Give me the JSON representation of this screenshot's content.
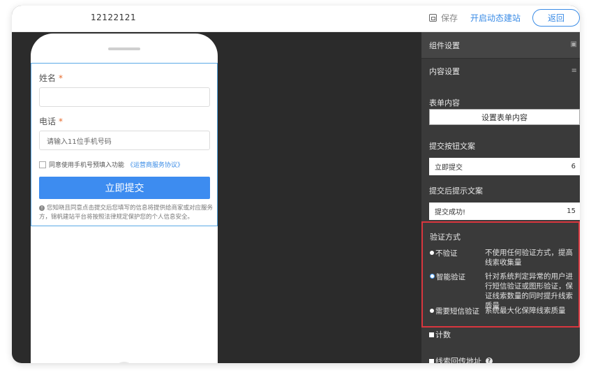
{
  "header": {
    "site_name": "12122121",
    "save_label": "保存",
    "start_label": "开启动态建站",
    "back_label": "返回"
  },
  "form": {
    "name_label": "姓名",
    "name_value": "",
    "phone_label": "电话",
    "phone_placeholder": "请输入11位手机号码",
    "required_mark": "*",
    "agree_text": "同意使用手机号预填入功能",
    "agree_link": "《运营商服务协议》",
    "submit_label": "立即提交",
    "disclaimer": "您知晓且同意点击提交后您填写的信息将提供给商家或对应服务方，锦帆建站平台将按照法律规定保护您的个人信息安全。"
  },
  "panel": {
    "component_settings": "组件设置",
    "content_settings": "内容设置",
    "form_content_label": "表单内容",
    "form_content_button": "设置表单内容",
    "submit_text_label": "提交按钮文案",
    "submit_text_value": "立即提交",
    "submit_text_count": "6",
    "after_submit_label": "提交后提示文案",
    "after_submit_value": "提交成功!",
    "after_submit_count": "15",
    "verify": {
      "title": "验证方式",
      "options": [
        {
          "label": "不验证",
          "desc": "不使用任何验证方式，提高线索收集量"
        },
        {
          "label": "智能验证",
          "desc": "针对系统判定异常的用户进行短信验证或图形验证，保证线索数量的同时提升线索质量"
        },
        {
          "label": "需要短信验证",
          "desc": "系统最大化保障线索质量"
        }
      ],
      "selected": "智能验证"
    },
    "count_label": "计数",
    "callback_label": "线索回传地址"
  },
  "colors": {
    "accent": "#3b8ce6",
    "submit_bg": "#3d8cf0",
    "highlight": "#d9363e",
    "panel_bg": "#3a3a3a"
  }
}
